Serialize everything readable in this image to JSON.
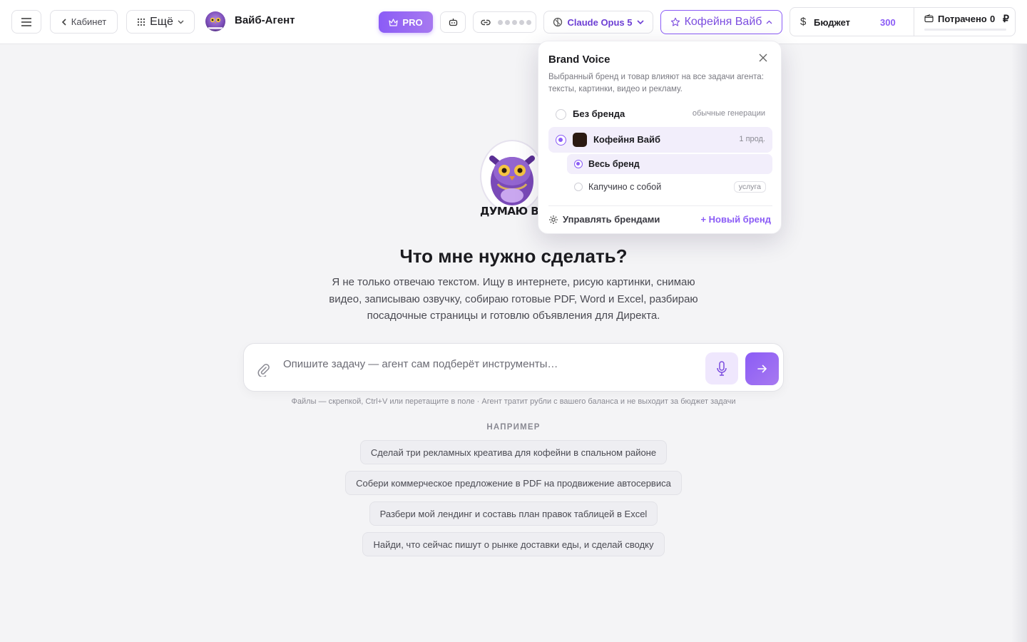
{
  "header": {
    "back_label": "Кабинет",
    "more_label": "Ещё",
    "app_title": "Вайб-Агент",
    "pro_label": "PRO",
    "model_label": "Claude Opus 5",
    "brand_label": "Кофейня Вайб",
    "budget_label": "Бюджет",
    "budget_value": "300",
    "spent_label": "Потрачено",
    "spent_value": "0",
    "currency": "₽",
    "spent_progress": 0
  },
  "main": {
    "mascot_caption": "ДУМАЮ ВСЛУХ",
    "heading": "Что мне нужно сделать?",
    "description": "Я не только отвечаю текстом. Ищу в интернете, рисую картинки, снимаю видео, записываю озвучку, собираю готовые PDF, Word и Excel, разбираю посадочные страницы и готовлю объявления для Директа.",
    "input_placeholder": "Опишите задачу — агент сам подберёт инструменты…",
    "input_value": "",
    "hint": "Файлы — скрепкой, Ctrl+V или перетащите в поле · Агент тратит рубли с вашего баланса и не выходит за бюджет задачи",
    "examples_label": "НАПРИМЕР",
    "examples": [
      "Сделай три рекламных креатива для кофейни в спальном районе",
      "Собери коммерческое предложение в PDF на продвижение автосервиса",
      "Разбери мой лендинг и составь план правок таблицей в Excel",
      "Найди, что сейчас пишут о рынке доставки еды, и сделай сводку"
    ]
  },
  "brand_popover": {
    "title": "Brand Voice",
    "description": "Выбранный бренд и товар влияют на все задачи агента: тексты, картинки, видео и рекламу.",
    "options": [
      {
        "label": "Без бренда",
        "note": "обычные генерации",
        "selected": false
      },
      {
        "label": "Кофейня Вайб",
        "note": "1 прод.",
        "selected": true,
        "swatch_color": "#2b1a12"
      }
    ],
    "sub_options": [
      {
        "label": "Весь бренд",
        "tag": "",
        "selected": true
      },
      {
        "label": "Капучино с собой",
        "tag": "услуга",
        "selected": false
      }
    ],
    "manage_label": "Управлять брендами",
    "new_brand_label": "+ Новый бренд"
  },
  "colors": {
    "accent": "#8b5cf6",
    "background": "#f4f4f6"
  },
  "icons": [
    "hamburger-icon",
    "chevron-left-icon",
    "grid-icon",
    "chevron-down-icon",
    "crown-icon",
    "robot-icon",
    "link-icon",
    "model-icon",
    "star-icon",
    "chevron-up-icon",
    "dollar-icon",
    "wallet-icon",
    "paperclip-icon",
    "microphone-icon",
    "arrow-right-icon",
    "close-icon",
    "gear-icon"
  ]
}
